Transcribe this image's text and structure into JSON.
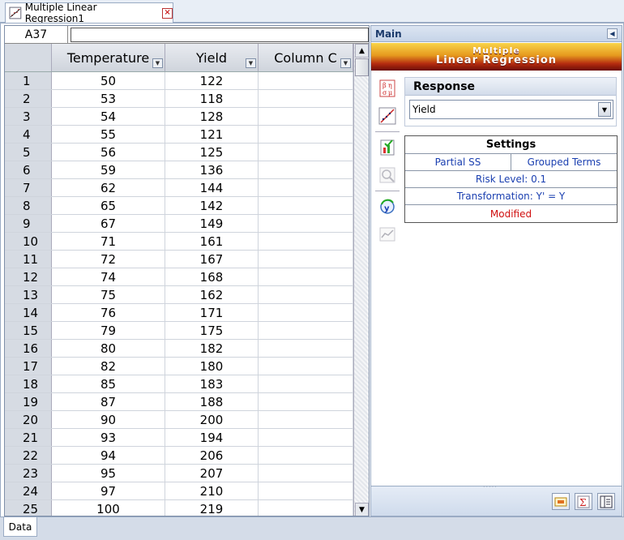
{
  "document_tab": {
    "title": "Multiple Linear Regression1"
  },
  "sheet": {
    "cell_ref": "A37",
    "formula_value": "",
    "columns": [
      "Temperature",
      "Yield",
      "Column C"
    ],
    "rows": [
      [
        "1",
        "50",
        "122",
        ""
      ],
      [
        "2",
        "53",
        "118",
        ""
      ],
      [
        "3",
        "54",
        "128",
        ""
      ],
      [
        "4",
        "55",
        "121",
        ""
      ],
      [
        "5",
        "56",
        "125",
        ""
      ],
      [
        "6",
        "59",
        "136",
        ""
      ],
      [
        "7",
        "62",
        "144",
        ""
      ],
      [
        "8",
        "65",
        "142",
        ""
      ],
      [
        "9",
        "67",
        "149",
        ""
      ],
      [
        "10",
        "71",
        "161",
        ""
      ],
      [
        "11",
        "72",
        "167",
        ""
      ],
      [
        "12",
        "74",
        "168",
        ""
      ],
      [
        "13",
        "75",
        "162",
        ""
      ],
      [
        "14",
        "76",
        "171",
        ""
      ],
      [
        "15",
        "79",
        "175",
        ""
      ],
      [
        "16",
        "80",
        "182",
        ""
      ],
      [
        "17",
        "82",
        "180",
        ""
      ],
      [
        "18",
        "85",
        "183",
        ""
      ],
      [
        "19",
        "87",
        "188",
        ""
      ],
      [
        "20",
        "90",
        "200",
        ""
      ],
      [
        "21",
        "93",
        "194",
        ""
      ],
      [
        "22",
        "94",
        "206",
        ""
      ],
      [
        "23",
        "95",
        "207",
        ""
      ],
      [
        "24",
        "97",
        "210",
        ""
      ],
      [
        "25",
        "100",
        "219",
        ""
      ]
    ]
  },
  "panel": {
    "title": "Main",
    "banner_line1": "Multiple",
    "banner_line2": "Linear Regression",
    "response": {
      "heading": "Response",
      "selected": "Yield"
    },
    "settings": {
      "title": "Settings",
      "partial_ss": "Partial SS",
      "grouped_terms": "Grouped Terms",
      "risk_level": "Risk Level: 0.1",
      "transformation": "Transformation: Y' = Y",
      "status": "Modified"
    },
    "tools": [
      "beta-mu-icon",
      "scatter-fit-icon",
      "checklist-chart-icon",
      "zoom-plot-icon",
      "recalculate-y-icon",
      "line-chart-icon"
    ]
  },
  "bottom_tab": {
    "label": "Data"
  },
  "colors": {
    "status_modified": "#d01010",
    "settings_link": "#1a3fb0",
    "banner_top": "#f8d34a",
    "banner_bottom": "#6b0c06"
  }
}
